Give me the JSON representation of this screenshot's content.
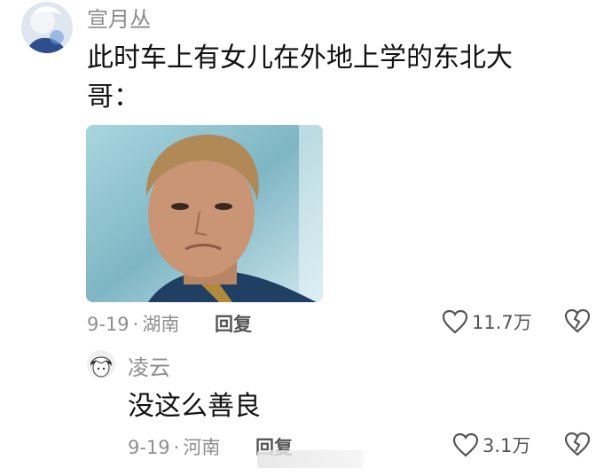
{
  "comment": {
    "username": "宣月丛",
    "text_line1": "此时车上有女儿在外地上学的东北大",
    "text_line2": "哥：",
    "date": "9-19",
    "location": "湖南",
    "reply_label": "回复",
    "like_count": "11.7万"
  },
  "reply": {
    "username": "凌云",
    "text": "没这么善良",
    "date": "9-19",
    "location": "河南",
    "reply_label": "回复",
    "like_count": "3.1万"
  },
  "separator": "·",
  "icons": [
    "avatar",
    "heart-icon",
    "broken-heart-icon"
  ]
}
